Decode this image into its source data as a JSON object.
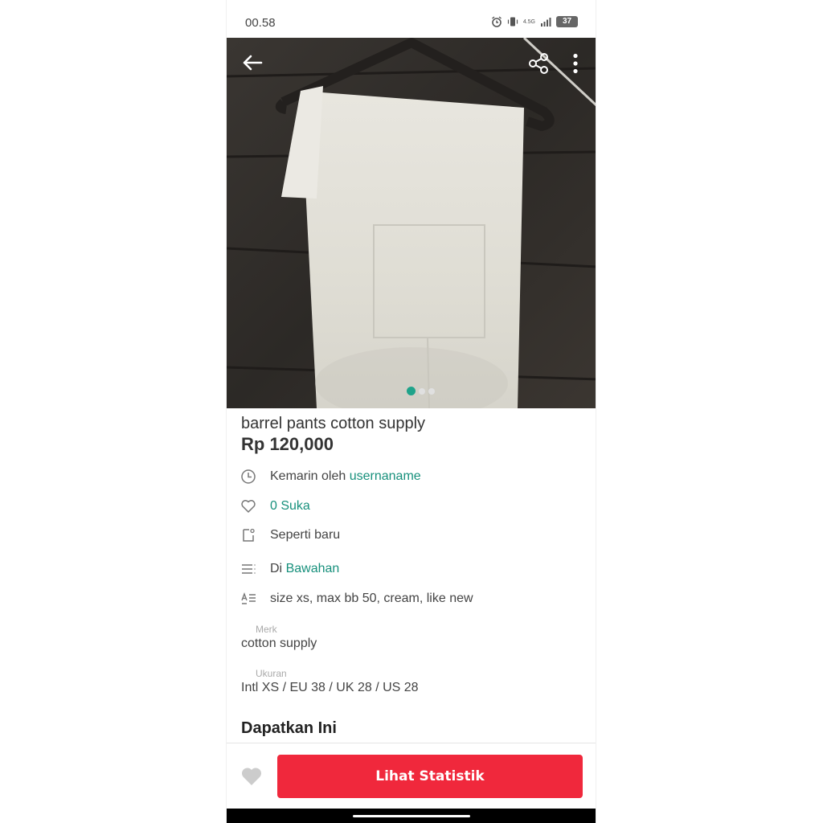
{
  "status_bar": {
    "time": "00.58",
    "network": "4.5G",
    "battery": "37"
  },
  "image_carousel": {
    "image_count": 3,
    "active_index": 0,
    "image_icon": "product-photo-white-pants-on-hanger",
    "back_icon": "arrow-left-icon",
    "share_icon": "share-icon",
    "more_icon": "more-vertical-icon"
  },
  "product": {
    "title": "barrel pants cotton supply",
    "price": "Rp 120,000"
  },
  "details": {
    "time_prefix": "Kemarin oleh ",
    "username": "usernaname",
    "likes": "0 Suka",
    "condition": "Seperti baru",
    "category_prefix": "Di ",
    "category": "Bawahan",
    "description": "size xs, max bb 50, cream, like new"
  },
  "attributes": {
    "merk_label": "Merk",
    "merk_value": "cotton supply",
    "size_label": "Ukuran",
    "size_value": "Intl XS / EU 38 / UK 28 / US 28"
  },
  "section": {
    "title": "Dapatkan Ini"
  },
  "bottom_bar": {
    "cta_label": "Lihat Statistik"
  },
  "colors": {
    "accent_green": "#17907c",
    "cta_red": "#f0283c"
  }
}
